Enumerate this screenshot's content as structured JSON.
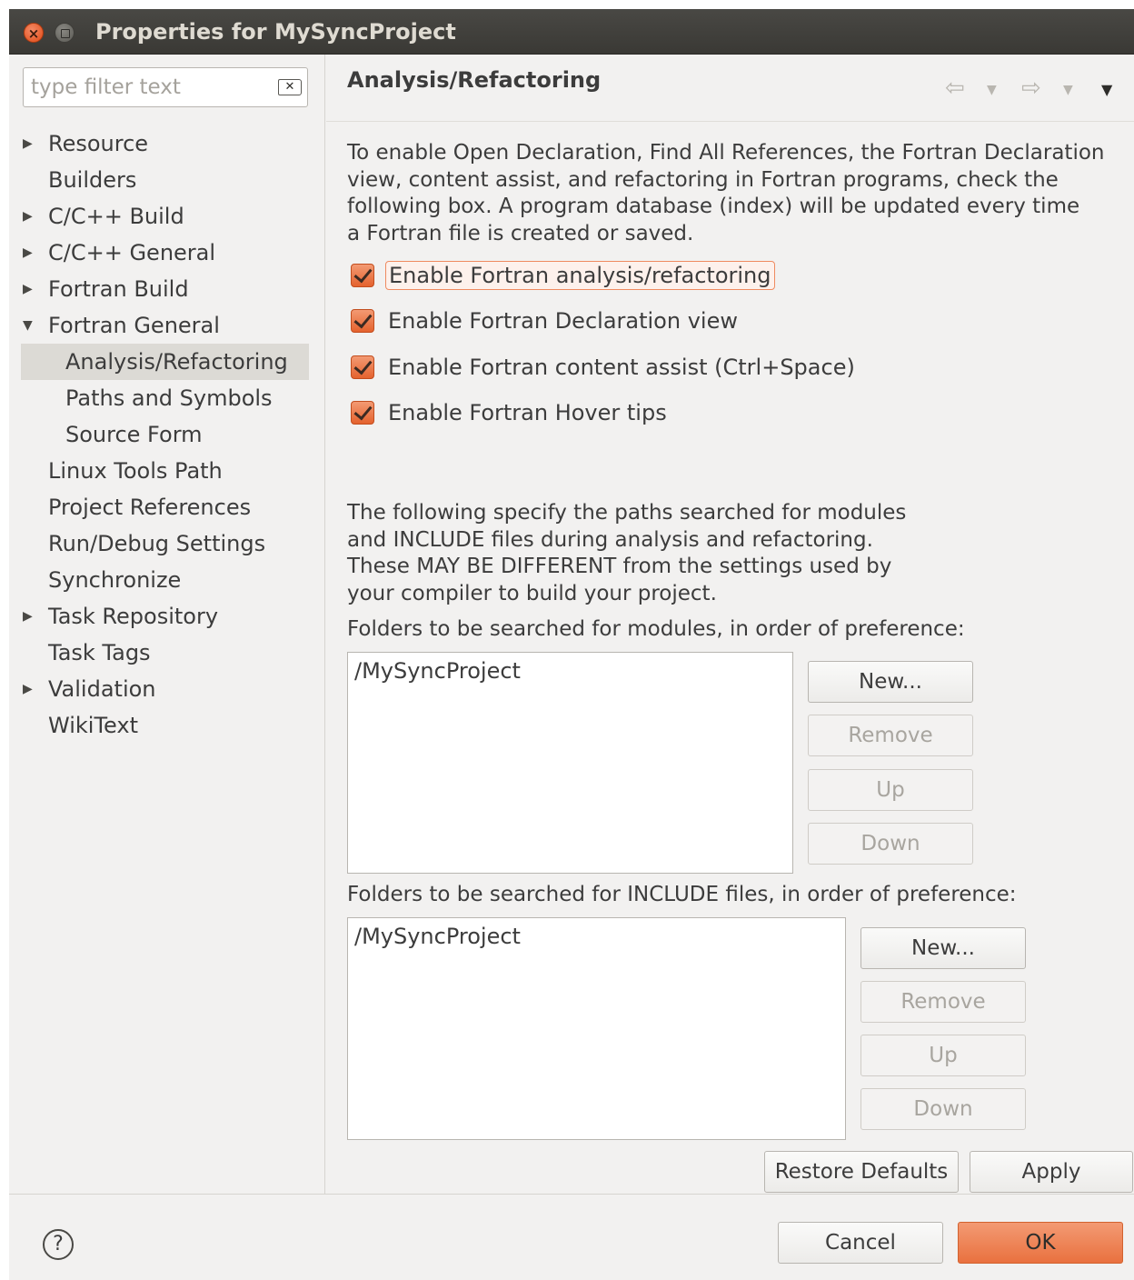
{
  "window": {
    "title": "Properties for MySyncProject"
  },
  "filter": {
    "placeholder": "type filter text"
  },
  "tree": [
    {
      "label": "Resource",
      "expandable": true,
      "expanded": false,
      "indent": 0
    },
    {
      "label": "Builders",
      "expandable": false,
      "indent": 0
    },
    {
      "label": "C/C++ Build",
      "expandable": true,
      "expanded": false,
      "indent": 0
    },
    {
      "label": "C/C++ General",
      "expandable": true,
      "expanded": false,
      "indent": 0
    },
    {
      "label": "Fortran Build",
      "expandable": true,
      "expanded": false,
      "indent": 0
    },
    {
      "label": "Fortran General",
      "expandable": true,
      "expanded": true,
      "indent": 0
    },
    {
      "label": "Analysis/Refactoring",
      "expandable": false,
      "indent": 1,
      "selected": true
    },
    {
      "label": "Paths and Symbols",
      "expandable": false,
      "indent": 1
    },
    {
      "label": "Source Form",
      "expandable": false,
      "indent": 1
    },
    {
      "label": "Linux Tools Path",
      "expandable": false,
      "indent": 0
    },
    {
      "label": "Project References",
      "expandable": false,
      "indent": 0
    },
    {
      "label": "Run/Debug Settings",
      "expandable": false,
      "indent": 0
    },
    {
      "label": "Synchronize",
      "expandable": false,
      "indent": 0
    },
    {
      "label": "Task Repository",
      "expandable": true,
      "expanded": false,
      "indent": 0
    },
    {
      "label": "Task Tags",
      "expandable": false,
      "indent": 0
    },
    {
      "label": "Validation",
      "expandable": true,
      "expanded": false,
      "indent": 0
    },
    {
      "label": "WikiText",
      "expandable": false,
      "indent": 0
    }
  ],
  "page": {
    "title": "Analysis/Refactoring",
    "intro": [
      "To enable Open Declaration, Find All References, the Fortran Declaration",
      "view, content assist, and refactoring in Fortran programs, check the",
      "following box.  A program database (index) will be updated every time",
      "a Fortran file is created or saved."
    ],
    "checkboxes": [
      {
        "label": "Enable Fortran analysis/refactoring",
        "checked": true
      },
      {
        "label": "Enable Fortran Declaration view",
        "checked": true
      },
      {
        "label": "Enable Fortran content assist (Ctrl+Space)",
        "checked": true
      },
      {
        "label": "Enable Fortran Hover tips",
        "checked": true
      }
    ],
    "paths_note": [
      "The following specify the paths searched for modules",
      "and INCLUDE files during analysis and refactoring.",
      "These MAY BE DIFFERENT from the settings used by",
      "your compiler to build your project."
    ],
    "modules_label": "Folders to be searched for modules, in order of preference:",
    "modules_entries": [
      "/MySyncProject"
    ],
    "include_label": "Folders to be searched for INCLUDE files, in order of preference:",
    "include_entries": [
      "/MySyncProject"
    ],
    "list_buttons": {
      "new": "New...",
      "remove": "Remove",
      "up": "Up",
      "down": "Down"
    },
    "restore_defaults": "Restore Defaults",
    "apply": "Apply"
  },
  "footer": {
    "help_glyph": "?",
    "cancel": "Cancel",
    "ok": "OK"
  },
  "colors": {
    "accent": "#e9713f",
    "titlebar": "#3a3935",
    "selection": "#dcdad5"
  }
}
